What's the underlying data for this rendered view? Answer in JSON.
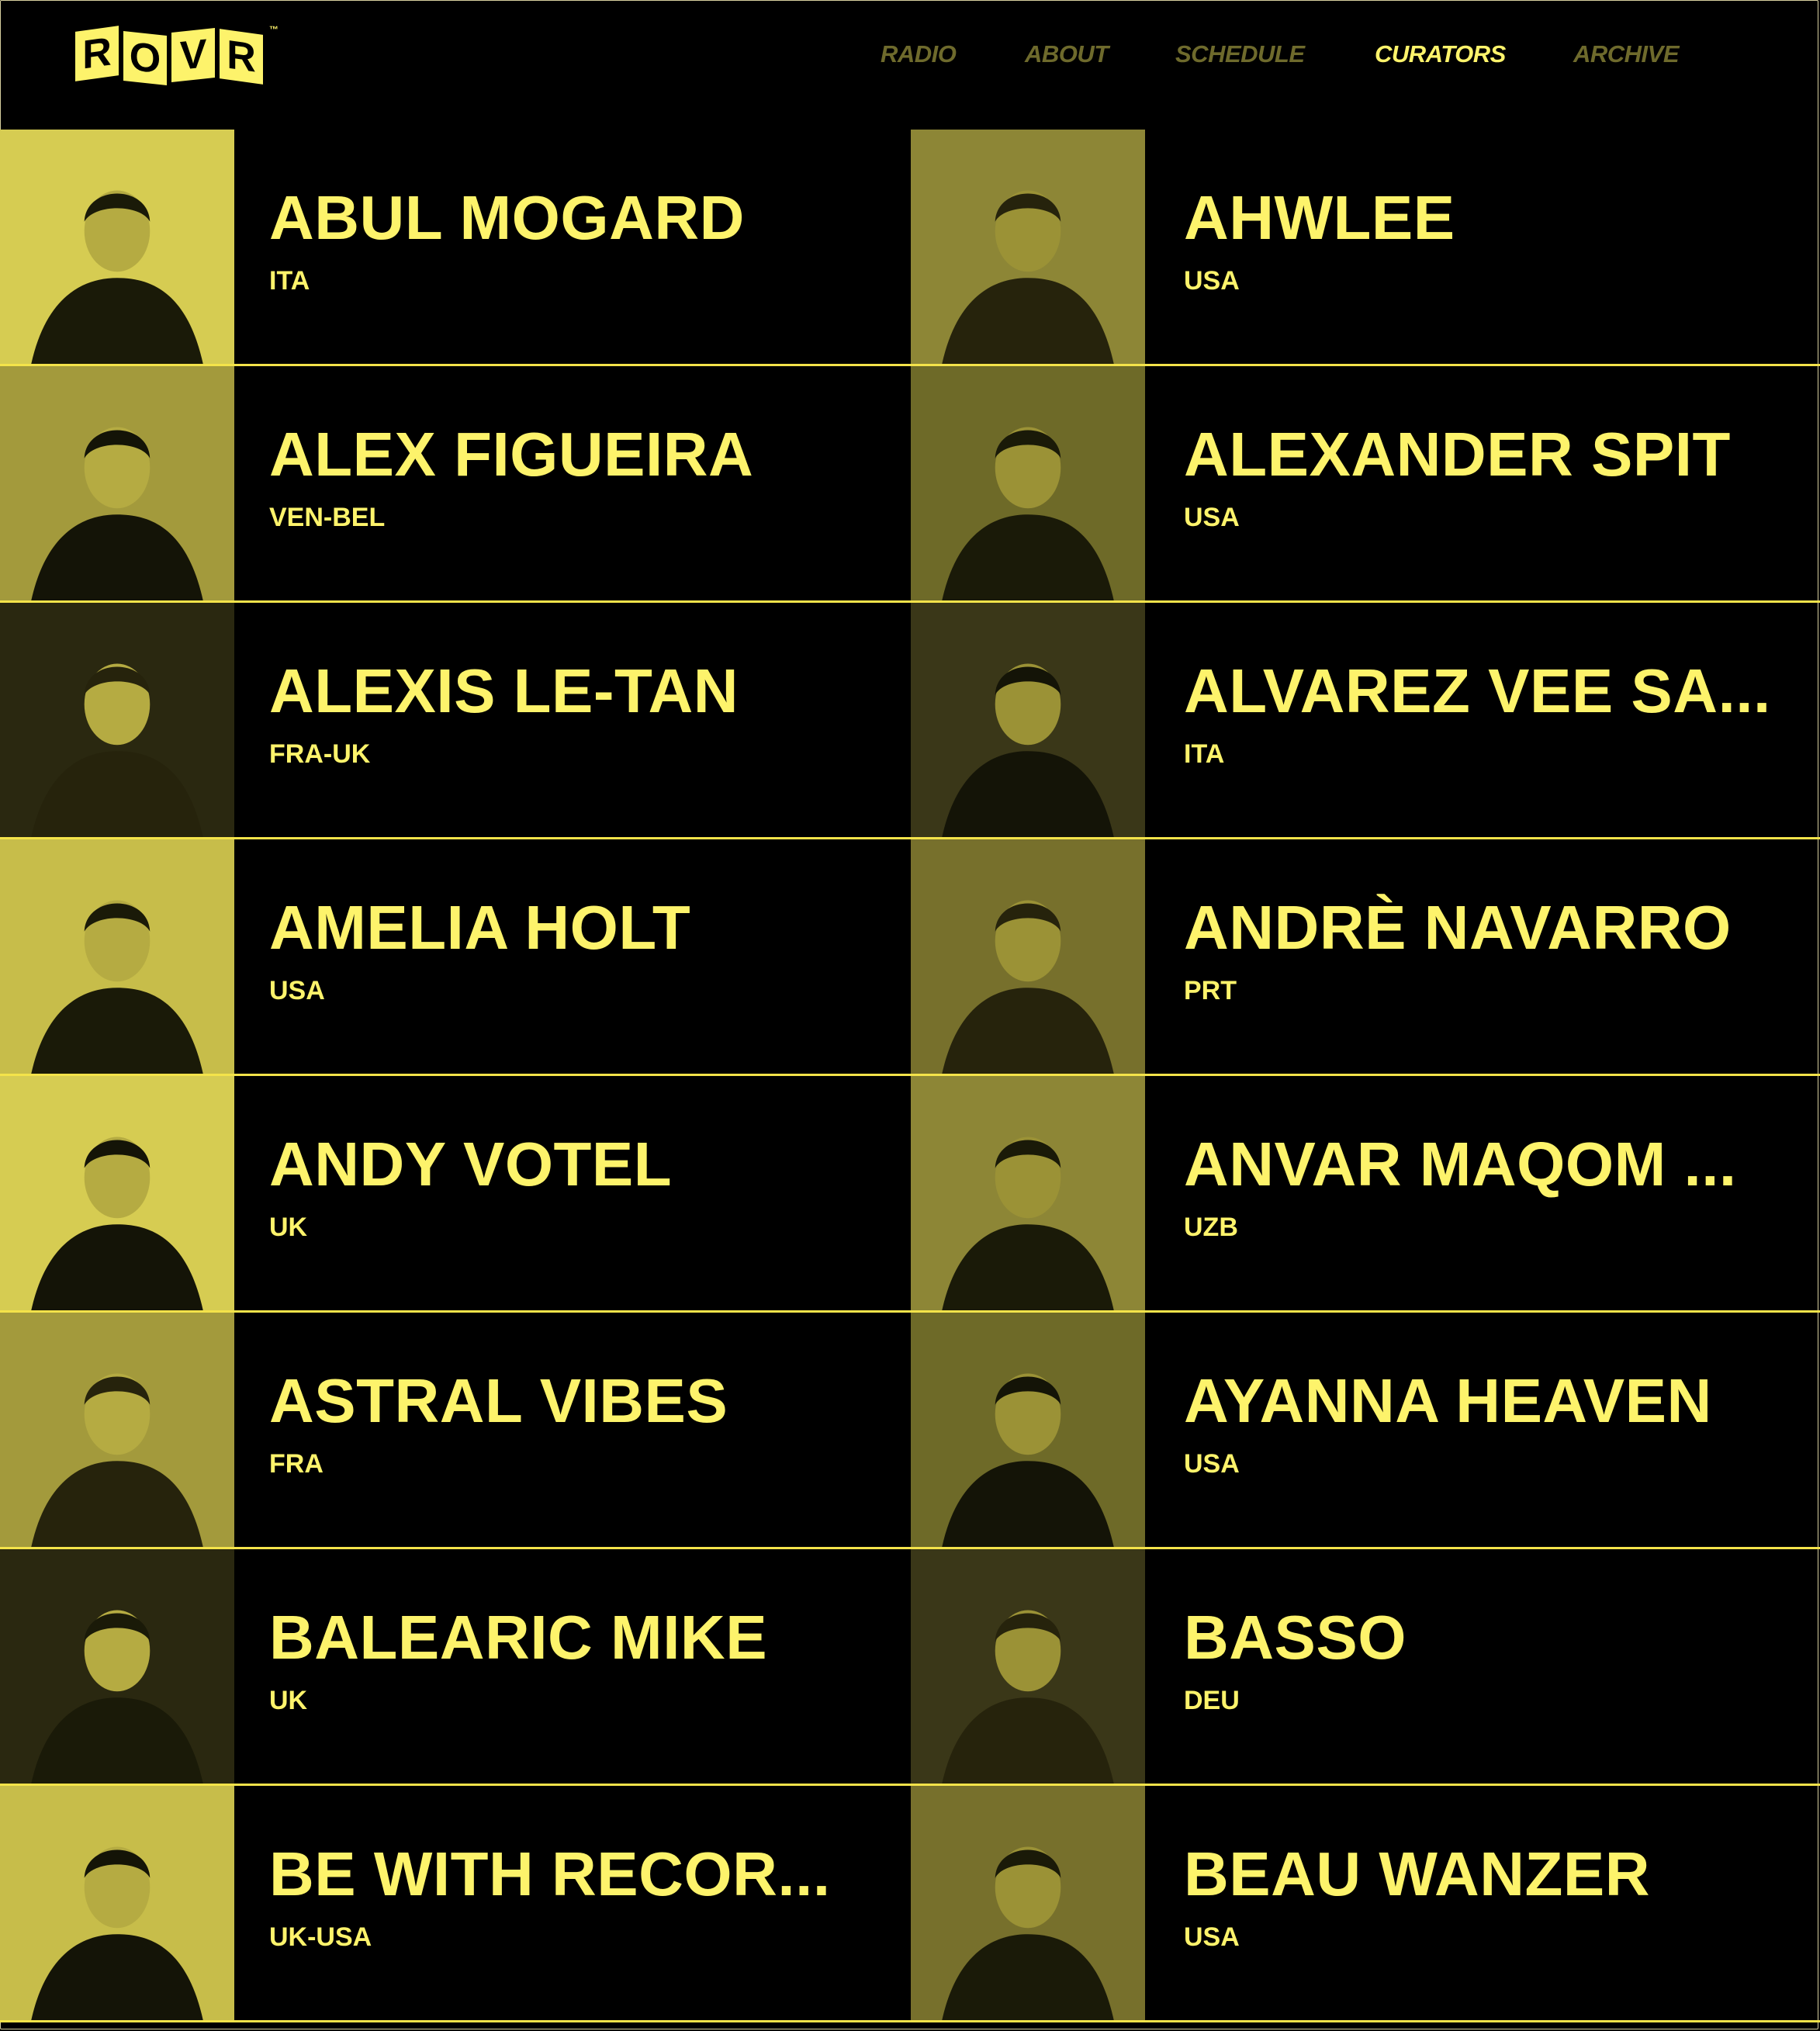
{
  "brand": {
    "logo_letters": [
      "R",
      "O",
      "V",
      "R"
    ],
    "trademark": "™",
    "color": "#fdf36b"
  },
  "nav": {
    "items": [
      {
        "label": "RADIO",
        "active": false
      },
      {
        "label": "ABOUT",
        "active": false
      },
      {
        "label": "SCHEDULE",
        "active": false
      },
      {
        "label": "CURATORS",
        "active": true
      },
      {
        "label": "ARCHIVE",
        "active": false
      }
    ]
  },
  "colors": {
    "background": "#000000",
    "accent": "#fdf36b",
    "nav_inactive": "#6e6a2c",
    "divider": "#f4e34a"
  },
  "curators": [
    {
      "name": "ABUL MOGARD",
      "country": "ITA",
      "photo": "man-portrait-icon"
    },
    {
      "name": "AHWLEE",
      "country": "USA",
      "photo": "record-studio-icon"
    },
    {
      "name": "ALEX FIGUEIRA",
      "country": "VEN-BEL",
      "photo": "man-with-record-icon"
    },
    {
      "name": "ALEXANDER SPIT",
      "country": "USA",
      "photo": "studio-seated-icon"
    },
    {
      "name": "ALEXIS LE-TAN",
      "country": "FRA-UK",
      "photo": "silhouette-icon"
    },
    {
      "name": "ALVAREZ VEE SA...",
      "country": "ITA",
      "photo": "winged-creature-icon"
    },
    {
      "name": "AMELIA HOLT",
      "country": "USA",
      "photo": "woman-portrait-icon"
    },
    {
      "name": "ANDRÈ NAVARRO",
      "country": "PRT",
      "photo": "man-cap-icon"
    },
    {
      "name": "ANDY VOTEL",
      "country": "UK",
      "photo": "bearded-man-icon"
    },
    {
      "name": "ANVAR MAQOM ...",
      "country": "UZB",
      "photo": "record-shelves-icon"
    },
    {
      "name": "ASTRAL VIBES",
      "country": "FRA",
      "photo": "man-hat-icon"
    },
    {
      "name": "AYANNA HEAVEN",
      "country": "USA",
      "photo": "woman-seated-icon"
    },
    {
      "name": "BALEARIC MIKE",
      "country": "UK",
      "photo": "man-sunglasses-icon"
    },
    {
      "name": "BASSO",
      "country": "DEU",
      "photo": "hands-abstract-icon"
    },
    {
      "name": "BE WITH RECOR...",
      "country": "UK-USA",
      "photo": "dj-turntables-icon"
    },
    {
      "name": "BEAU WANZER",
      "country": "USA",
      "photo": "keyboard-player-icon"
    }
  ]
}
